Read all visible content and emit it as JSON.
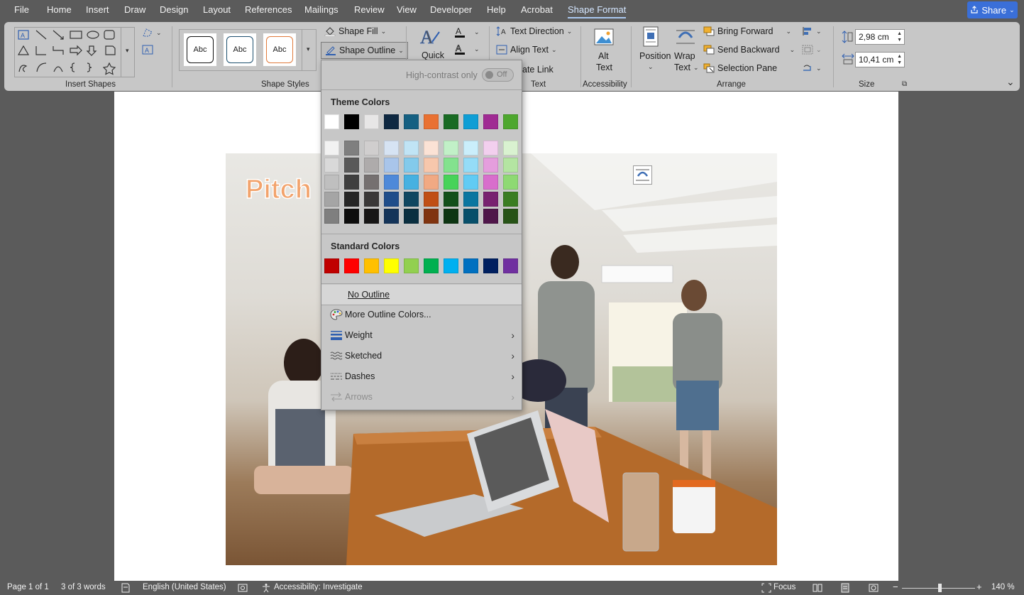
{
  "menubar": {
    "items": [
      "File",
      "Home",
      "Insert",
      "Draw",
      "Design",
      "Layout",
      "References",
      "Mailings",
      "Review",
      "View",
      "Developer",
      "Help",
      "Acrobat",
      "Shape Format"
    ],
    "active": "Shape Format",
    "share": "Share"
  },
  "ribbon": {
    "insert_shapes": {
      "label": "Insert Shapes"
    },
    "shape_styles": {
      "label": "Shape Styles",
      "thumb_text": "Abc"
    },
    "shape_fill": "Shape Fill",
    "shape_outline": "Shape Outline",
    "quick": "Quick",
    "text_direction": "Text Direction",
    "align_text": "Align Text",
    "create_link": "ate Link",
    "text_group": "Text",
    "alt_text": {
      "line1": "Alt",
      "line2": "Text"
    },
    "accessibility": "Accessibility",
    "position": "Position",
    "wrap_text": {
      "line1": "Wrap",
      "line2": "Text"
    },
    "bring_forward": "Bring Forward",
    "send_backward": "Send Backward",
    "selection_pane": "Selection Pane",
    "arrange": "Arrange",
    "height": "2,98 cm",
    "width": "10,41 cm",
    "size": "Size"
  },
  "document": {
    "image_text": "Pitch"
  },
  "outline_menu": {
    "high_contrast": "High-contrast only",
    "toggle": "Off",
    "theme_colors": "Theme Colors",
    "standard_colors": "Standard Colors",
    "theme_top": [
      "#ffffff",
      "#000000",
      "#e7e6e6",
      "#0e2841",
      "#156082",
      "#e97132",
      "#196b24",
      "#0f9ed5",
      "#a02b93",
      "#4ea72e"
    ],
    "theme_shades": [
      [
        "#f2f2f2",
        "#7f7f7f",
        "#d0cece",
        "#d6e3f3",
        "#c0e4f5",
        "#fbe2d5",
        "#c1f0c7",
        "#caeefb",
        "#f2cfee",
        "#d9f2d0"
      ],
      [
        "#d9d9d9",
        "#595959",
        "#aeabab",
        "#a9c5ea",
        "#83caeb",
        "#f7c7ac",
        "#83e28e",
        "#95dcf7",
        "#e59edd",
        "#b4e5a2"
      ],
      [
        "#bfbfbf",
        "#3f3f3f",
        "#757070",
        "#4e89d9",
        "#46b1e1",
        "#f1a983",
        "#47d359",
        "#61cbf4",
        "#d86ecc",
        "#8ed973"
      ],
      [
        "#a5a5a5",
        "#262626",
        "#3a3838",
        "#1f4d8a",
        "#0f4761",
        "#c04f15",
        "#124f1a",
        "#0b76a0",
        "#782170",
        "#3a7d22"
      ],
      [
        "#7f7f7f",
        "#0d0d0d",
        "#171616",
        "#143459",
        "#0a2f40",
        "#803410",
        "#0d3512",
        "#074f6a",
        "#4f164a",
        "#275317"
      ]
    ],
    "standard": [
      "#c00000",
      "#ff0000",
      "#ffc000",
      "#ffff00",
      "#92d050",
      "#00b050",
      "#00b0f0",
      "#0070c0",
      "#002060",
      "#7030a0"
    ],
    "no_outline": "No Outline",
    "more_colors": "More Outline Colors...",
    "weight": "Weight",
    "sketched": "Sketched",
    "dashes": "Dashes",
    "arrows": "Arrows"
  },
  "status": {
    "page": "Page 1 of 1",
    "words": "3 of 3 words",
    "language": "English (United States)",
    "accessibility": "Accessibility: Investigate",
    "focus": "Focus",
    "zoom": "140 %"
  }
}
